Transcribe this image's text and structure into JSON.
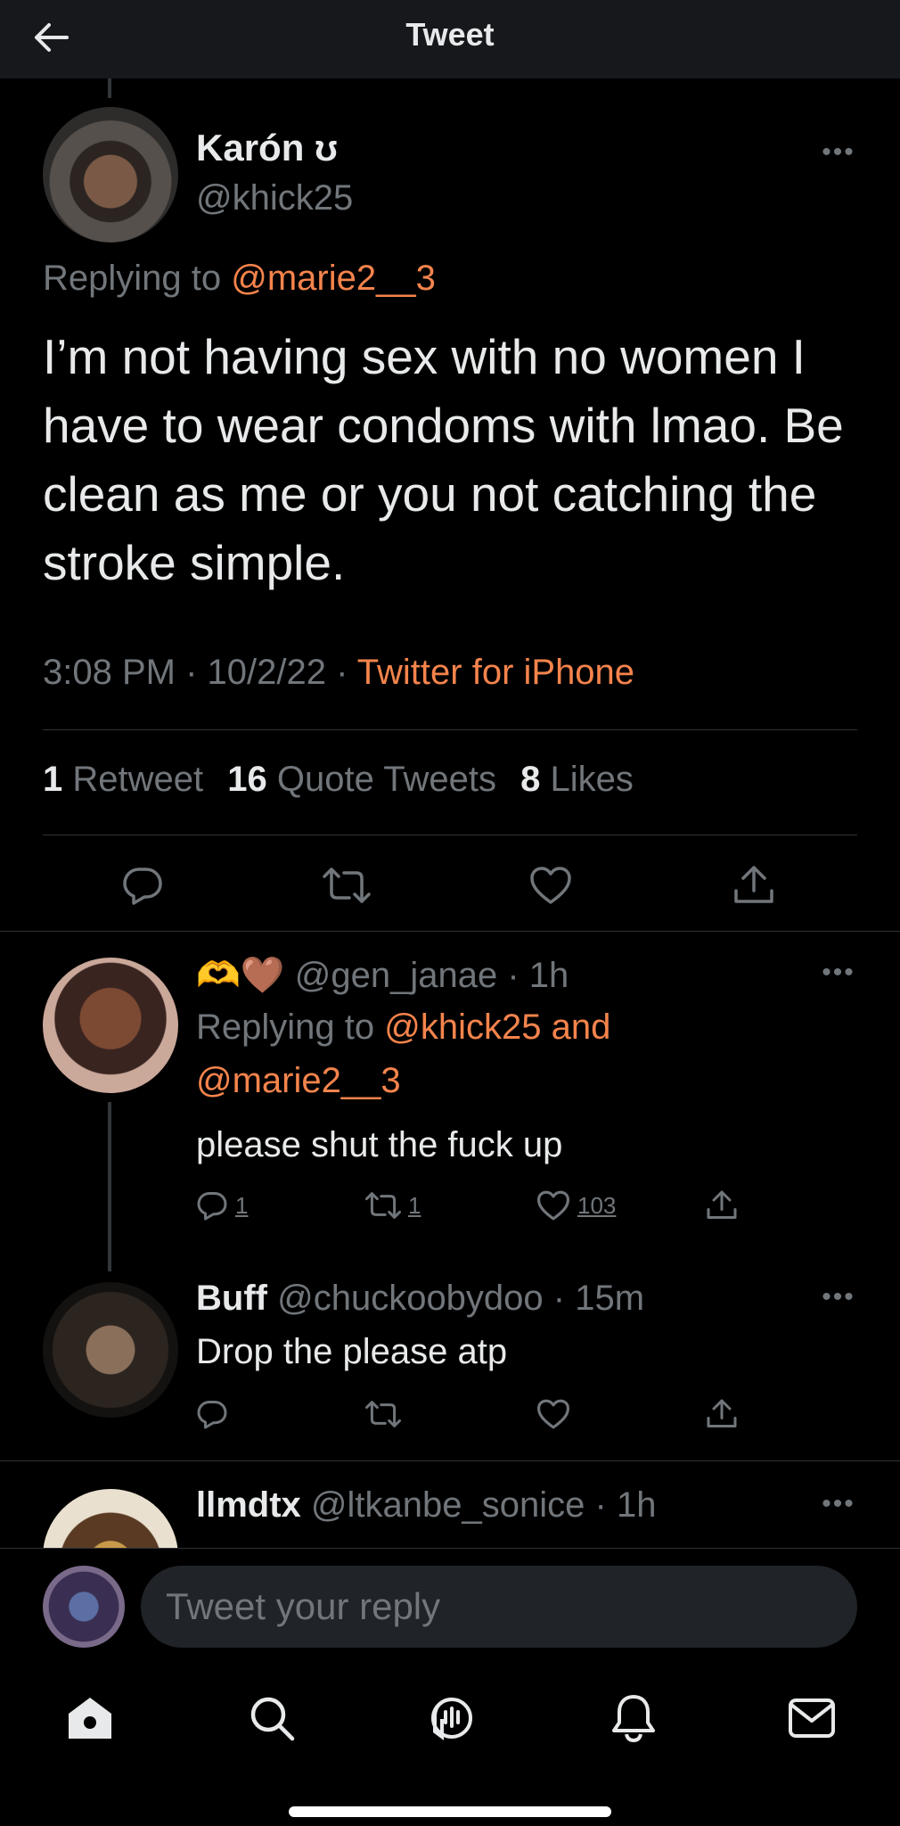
{
  "header": {
    "title": "Tweet"
  },
  "main_tweet": {
    "name": "Karón ☪",
    "name_display": "Karón ʊ",
    "handle": "@khick25",
    "replying_prefix": "Replying to ",
    "replying_to": "@marie2__3",
    "text": "I’m not having sex with no women I have to wear condoms with lmao. Be clean as me or you not catching the stroke simple.",
    "time": "3:08 PM · 10/2/22 · ",
    "source": "Twitter for iPhone",
    "stats": {
      "retweets_count": "1",
      "retweets_label": "Retweet",
      "quotes_count": "16",
      "quotes_label": "Quote Tweets",
      "likes_count": "8",
      "likes_label": "Likes"
    }
  },
  "replies": [
    {
      "name": "🫶🤎",
      "handle": "@gen_janae",
      "time": "· 1h",
      "replying_prefix": "Replying to ",
      "replying_to": "@khick25 and",
      "replying_to_2": "@marie2__3",
      "text": "please shut the fuck up",
      "replies": "1",
      "retweets": "1",
      "likes": "103"
    },
    {
      "name": "Buff",
      "handle": "@chuckoobydoo",
      "time": "· 15m",
      "text": "Drop the please atp"
    },
    {
      "name": "llmdtx",
      "handle": "@ltkanbe_sonice",
      "time": "· 1h"
    }
  ],
  "compose": {
    "placeholder": "Tweet your reply"
  },
  "colors": {
    "accent": "#f5844c",
    "muted": "#71767b",
    "text": "#e7e9ea",
    "bg": "#000000"
  },
  "icons": [
    "back-arrow-icon",
    "more-icon",
    "reply-icon",
    "retweet-icon",
    "like-icon",
    "share-icon",
    "home-icon",
    "search-icon",
    "spaces-icon",
    "notifications-icon",
    "messages-icon"
  ]
}
